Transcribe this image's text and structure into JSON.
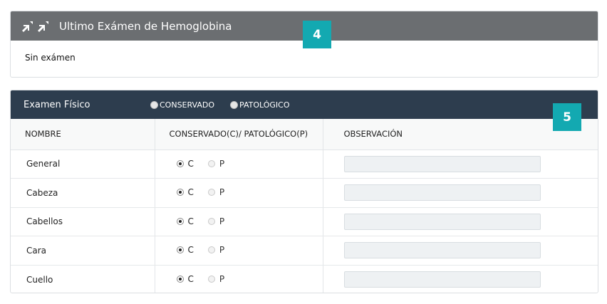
{
  "panel_hemoglobina": {
    "title": "Ultimo Exámen de Hemoglobina",
    "body_text": "Sin exámen",
    "badge": "4",
    "icons": [
      "compress-icon",
      "compress-icon"
    ]
  },
  "panel_examen": {
    "title": "Examen Físico",
    "options": [
      "CONSERVADO",
      "PATOLÓGICO"
    ],
    "badge": "5",
    "columns": [
      "NOMBRE",
      "CONSERVADO(C)/ PATOLÓGICO(P)",
      "OBSERVACIÓN"
    ],
    "choice_labels": {
      "c": "C",
      "p": "P"
    },
    "rows": [
      {
        "name": "General",
        "selected": "C",
        "observacion": ""
      },
      {
        "name": "Cabeza",
        "selected": "C",
        "observacion": ""
      },
      {
        "name": "Cabellos",
        "selected": "C",
        "observacion": ""
      },
      {
        "name": "Cara",
        "selected": "C",
        "observacion": ""
      },
      {
        "name": "Cuello",
        "selected": "C",
        "observacion": ""
      }
    ]
  },
  "colors": {
    "panel1_header": "#6b6e71",
    "panel2_header": "#2d3d4e",
    "badge": "#13a9b1"
  }
}
